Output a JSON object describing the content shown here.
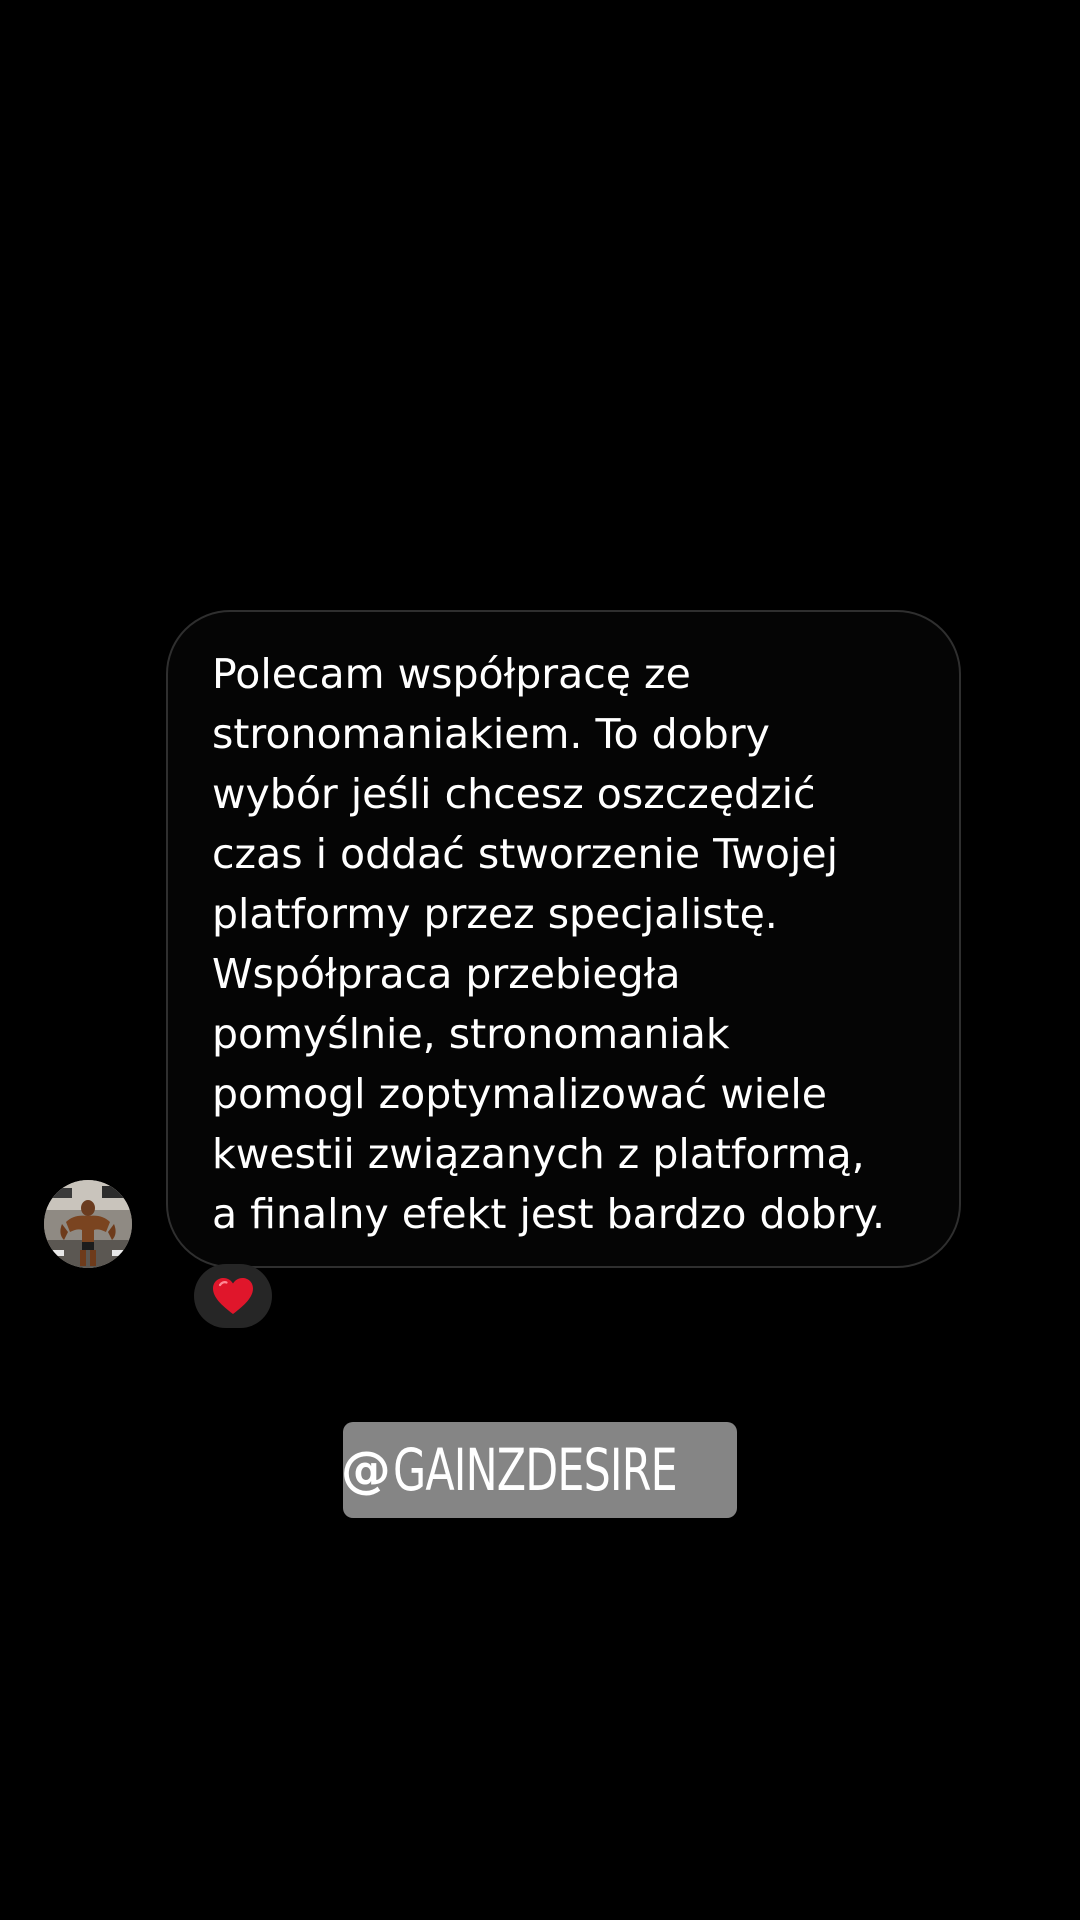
{
  "message": {
    "lines": [
      "Polecam współpracę ze",
      "stronomaniakiem. To dobry",
      "wybór jeśli chcesz oszczędzić",
      "czas i oddać stworzenie Twojej",
      "platformy przez specjalistę.",
      "Współpraca przebiegła",
      "pomyślnie, stronomaniak",
      "pomogl zoptymalizować wiele",
      "kwestii związanych z platformą,",
      "a finalny efekt jest bardzo dobry."
    ]
  },
  "reaction": {
    "icon": "red-heart-icon",
    "color": "#e0162b"
  },
  "mention": {
    "at_symbol": "@",
    "handle": "GAINZDESIRE"
  },
  "colors": {
    "background": "#000000",
    "bubble_border": "#2f2f2f",
    "text": "#ffffff",
    "reaction_bg": "#262626",
    "sticker_bg": "#858585"
  }
}
